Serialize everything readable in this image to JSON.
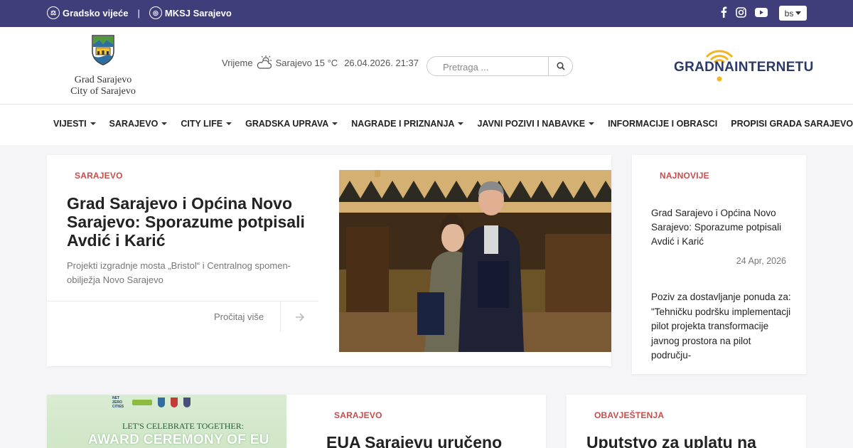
{
  "topbar": {
    "link1": "Gradsko vijeće",
    "separator": "|",
    "link2": "MKSJ Sarajevo",
    "lang": "bs",
    "social_icons": [
      "facebook-icon",
      "instagram-icon",
      "youtube-icon"
    ]
  },
  "header": {
    "logo_line1": "Grad Sarajevo",
    "logo_line2": "City of Sarajevo",
    "weather_label": "Vrijeme",
    "weather_icon": "cloud-sun-icon",
    "weather_city": "Sarajevo 15 °C",
    "datetime": "26.04.2026. 21:37",
    "search_placeholder": "Pretraga ...",
    "portal_logo": "GRADNAINTERNETU",
    "portal_logo_accent": "#f2b623"
  },
  "nav": {
    "items": [
      {
        "label": "VIJESTI",
        "dropdown": true
      },
      {
        "label": "SARAJEVO",
        "dropdown": true
      },
      {
        "label": "CITY LIFE",
        "dropdown": true
      },
      {
        "label": "GRADSKA UPRAVA",
        "dropdown": true
      },
      {
        "label": "NAGRADE I PRIZNANJA",
        "dropdown": true
      },
      {
        "label": "JAVNI POZIVI I NABAVKE",
        "dropdown": true
      },
      {
        "label": "INFORMACIJE I OBRASCI",
        "dropdown": false
      },
      {
        "label": "PROPISI GRADA SARAJEVO",
        "dropdown": false
      }
    ]
  },
  "featured": {
    "category": "SARAJEVO",
    "title": "Grad Sarajevo i Općina Novo Sarajevo: Sporazume potpisali Avdić i Karić",
    "lead": "Projekti izgradnje mosta „Bristol“ i Centralnog spomen-obilježja Novo Sarajevo",
    "read_more": "Pročitaj više"
  },
  "latest": {
    "category": "NAJNOVIJE",
    "items": [
      {
        "title": "Grad Sarajevo i Općina Novo Sarajevo: Sporazume potpisali Avdić i Karić",
        "date": "24 Apr, 2026"
      },
      {
        "title": "Poziv za dostavljanje ponuda za: \"Tehničku podršku implementacji pilot projekta transformacije javnog prostora na pilot području-",
        "date": ""
      }
    ]
  },
  "bottom": [
    {
      "category": "SARAJEVO",
      "title": "EUA Sarajevu uručeno",
      "image_text": "LET'S CELEBRATE TOGETHER:",
      "image_headline": "AWARD CEREMONY OF EU",
      "image_logo_text": "NET ZERO CITIES"
    },
    {
      "category": "OBAVJEŠTENJA",
      "title": "Uputstvo za uplatu na"
    }
  ],
  "colors": {
    "topbar": "#3f3d7a",
    "category": "#c94b4b",
    "background": "#f5f5f7"
  }
}
